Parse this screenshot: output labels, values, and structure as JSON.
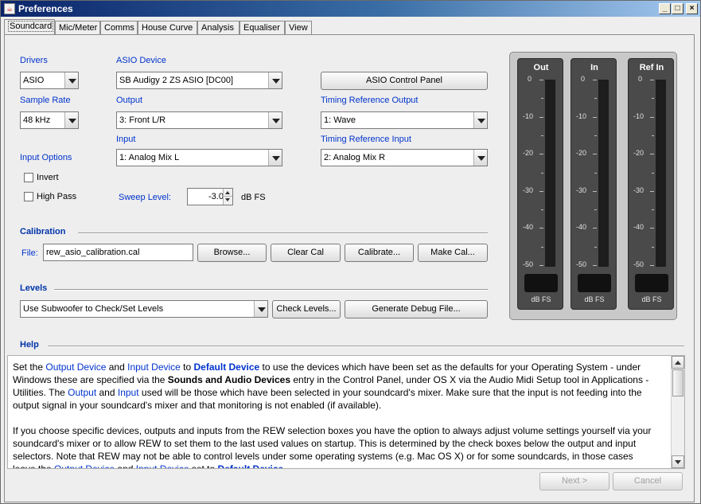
{
  "window": {
    "title": "Preferences",
    "app_icon": "java-cup-icon",
    "minimize": "_",
    "maximize": "□",
    "close": "×"
  },
  "tabs": [
    "Soundcard",
    "Mic/Meter",
    "Comms",
    "House Curve",
    "Analysis",
    "Equaliser",
    "View"
  ],
  "soundcard": {
    "drivers_label": "Drivers",
    "drivers_value": "ASIO",
    "asio_device_label": "ASIO Device",
    "asio_device_value": "SB Audigy 2 ZS ASIO [DC00]",
    "asio_control_panel": "ASIO Control Panel",
    "sample_rate_label": "Sample Rate",
    "sample_rate_value": "48 kHz",
    "output_label": "Output",
    "output_value": "3: Front L/R",
    "timing_ref_output_label": "Timing Reference Output",
    "timing_ref_output_value": "1: Wave",
    "input_label": "Input",
    "input_value": "1: Analog Mix L",
    "timing_ref_input_label": "Timing Reference Input",
    "timing_ref_input_value": "2: Analog Mix R",
    "input_options_label": "Input Options",
    "invert_label": "Invert",
    "high_pass_label": "High Pass",
    "sweep_level_label": "Sweep Level:",
    "sweep_level_value": "-3.0",
    "sweep_level_unit": "dB FS"
  },
  "calibration": {
    "section_label": "Calibration",
    "file_label": "File:",
    "file_value": "rew_asio_calibration.cal",
    "browse": "Browse...",
    "clear_cal": "Clear Cal",
    "calibrate": "Calibrate...",
    "make_cal": "Make Cal..."
  },
  "levels": {
    "section_label": "Levels",
    "mode_value": "Use Subwoofer to Check/Set Levels",
    "check_levels": "Check Levels...",
    "generate_debug": "Generate Debug File..."
  },
  "meters": {
    "names": [
      "Out",
      "In",
      "Ref In"
    ],
    "ticks": [
      "0",
      "-10",
      "-20",
      "-30",
      "-40",
      "-50"
    ],
    "unit": "dB FS"
  },
  "help": {
    "section_label": "Help",
    "p1": [
      {
        "t": "Set the ",
        "s": ""
      },
      {
        "t": "Output Device",
        "s": "hl"
      },
      {
        "t": " and ",
        "s": ""
      },
      {
        "t": "Input Device",
        "s": "hl"
      },
      {
        "t": " to ",
        "s": ""
      },
      {
        "t": "Default Device",
        "s": "hlb"
      },
      {
        "t": " to use the devices which have been set as the defaults for your Operating System - under Windows these are specified via the ",
        "s": ""
      },
      {
        "t": "Sounds and Audio Devices",
        "s": "b"
      },
      {
        "t": " entry in the Control Panel, under OS X via the Audio Midi Setup tool in Applications - Utilities. The ",
        "s": ""
      },
      {
        "t": "Output",
        "s": "hl"
      },
      {
        "t": " and ",
        "s": ""
      },
      {
        "t": "Input",
        "s": "hl"
      },
      {
        "t": " used will be those which have been selected in your soundcard's mixer. Make sure that the input is not feeding into the output signal in your soundcard's mixer and that monitoring is not enabled (if available).",
        "s": ""
      }
    ],
    "p2": [
      {
        "t": "If you choose specific devices, outputs and inputs from the REW selection boxes you have the option to always adjust volume settings yourself via your soundcard's mixer or to allow REW to set them to the last used values on startup. This is determined by the check boxes below the output and input selectors. Note that REW may not be able to control levels under some operating systems (e.g. Mac OS X) or for some soundcards, in those cases leave the ",
        "s": ""
      },
      {
        "t": "Output Device",
        "s": "hl"
      },
      {
        "t": " and ",
        "s": ""
      },
      {
        "t": "Input Device",
        "s": "hl"
      },
      {
        "t": " set to ",
        "s": ""
      },
      {
        "t": "Default Device",
        "s": "hlb"
      },
      {
        "t": ".",
        "s": ""
      }
    ]
  },
  "footer": {
    "next": "Next >",
    "cancel": "Cancel"
  }
}
